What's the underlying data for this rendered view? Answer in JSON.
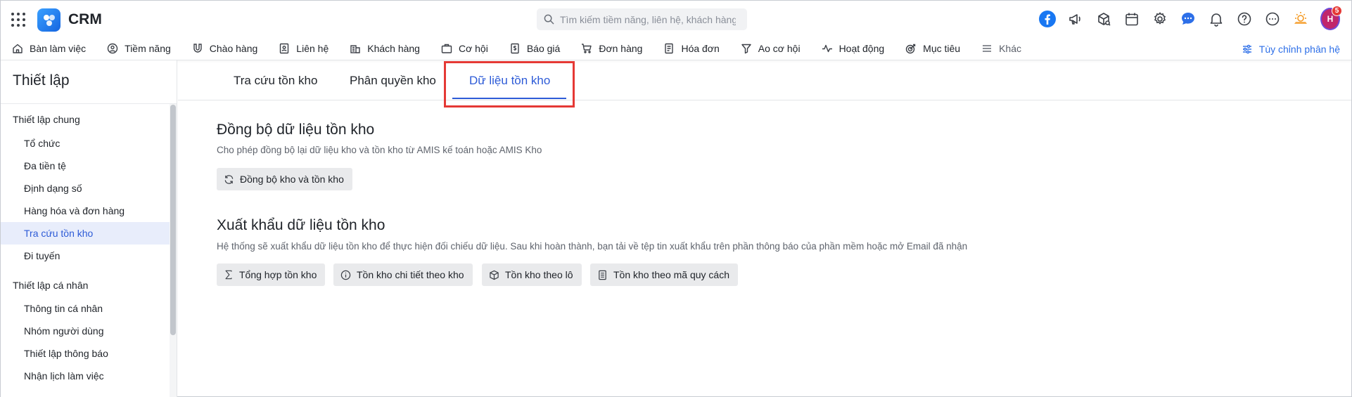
{
  "header": {
    "brand": "CRM",
    "search_placeholder": "Tìm kiếm tiềm năng, liên hệ, khách hàng",
    "avatar_initials": "H",
    "notification_count": "5"
  },
  "nav": {
    "items": [
      {
        "label": "Bàn làm việc",
        "icon": "home-icon"
      },
      {
        "label": "Tiềm năng",
        "icon": "user-icon"
      },
      {
        "label": "Chào hàng",
        "icon": "magnet-icon"
      },
      {
        "label": "Liên hệ",
        "icon": "contact-icon"
      },
      {
        "label": "Khách hàng",
        "icon": "building-icon"
      },
      {
        "label": "Cơ hội",
        "icon": "briefcase-icon"
      },
      {
        "label": "Báo giá",
        "icon": "quote-icon"
      },
      {
        "label": "Đơn hàng",
        "icon": "cart-icon"
      },
      {
        "label": "Hóa đơn",
        "icon": "invoice-icon"
      },
      {
        "label": "Ao cơ hội",
        "icon": "funnel-icon"
      },
      {
        "label": "Hoạt động",
        "icon": "activity-icon"
      },
      {
        "label": "Mục tiêu",
        "icon": "target-icon"
      }
    ],
    "more_label": "Khác",
    "customize_label": "Tùy chỉnh phân hệ"
  },
  "sidebar": {
    "title": "Thiết lập",
    "groups": [
      {
        "label": "Thiết lập chung",
        "items": [
          "Tổ chức",
          "Đa tiền tệ",
          "Định dạng số",
          "Hàng hóa và đơn hàng",
          "Tra cứu tồn kho",
          "Đi tuyến"
        ]
      },
      {
        "label": "Thiết lập cá nhân",
        "items": [
          "Thông tin cá nhân",
          "Nhóm người dùng",
          "Thiết lập thông báo",
          "Nhận lịch làm việc"
        ]
      }
    ],
    "active_item": "Tra cứu tồn kho"
  },
  "tabs": {
    "items": [
      "Tra cứu tồn kho",
      "Phân quyền kho",
      "Dữ liệu tồn kho"
    ],
    "active": "Dữ liệu tồn kho"
  },
  "sync_section": {
    "title": "Đồng bộ dữ liệu tồn kho",
    "description": "Cho phép đồng bộ lại dữ liệu kho và tồn kho từ AMIS kế toán hoặc AMIS Kho",
    "button_label": "Đồng bộ kho và tồn kho"
  },
  "export_section": {
    "title": "Xuất khẩu dữ liệu tồn kho",
    "description": "Hệ thống sẽ xuất khẩu dữ liệu tồn kho để thực hiện đối chiếu dữ liệu. Sau khi hoàn thành, bạn tải về tệp tin xuất khẩu trên phần thông báo của phần mềm hoặc mở Email đã nhận",
    "buttons": [
      "Tổng hợp tồn kho",
      "Tồn kho chi tiết theo kho",
      "Tồn kho theo lô",
      "Tồn kho theo mã quy cách"
    ]
  },
  "colors": {
    "accent": "#2d5bd7",
    "highlight": "#e53935",
    "active_bg": "#e8edfb"
  }
}
